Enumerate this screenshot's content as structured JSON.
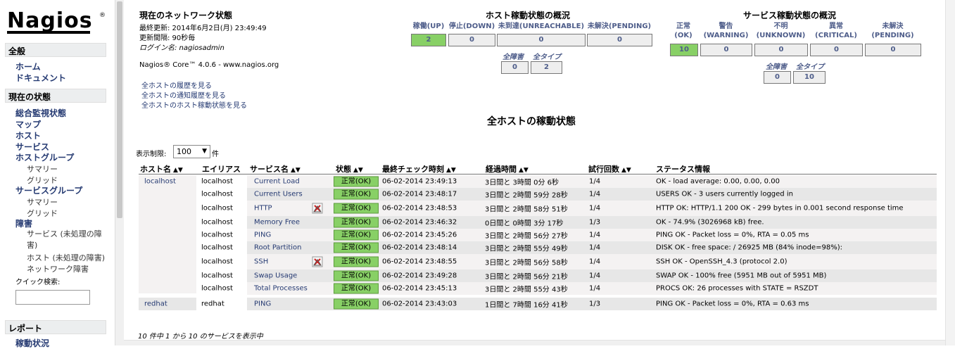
{
  "sidebar": {
    "logo": "Nagios",
    "sections": [
      {
        "title": "全般"
      },
      {
        "title": "現在の状態"
      },
      {
        "title": "レポート"
      }
    ],
    "general": [
      "ホーム",
      "ドキュメント"
    ],
    "current": [
      "総合監視状態",
      "マップ",
      "ホスト",
      "サービス",
      "ホストグループ"
    ],
    "hostgroup_sub": [
      "サマリー",
      "グリッド"
    ],
    "servicegroup": "サービスグループ",
    "servicegroup_sub": [
      "サマリー",
      "グリッド"
    ],
    "problems": "障害",
    "problems_sub": [
      "サービス (未処理の障害)",
      "ホスト (未処理の障害)",
      "ネットワーク障害"
    ],
    "quick_search_label": "クイック検索:",
    "reports_first": "稼動状況"
  },
  "info": {
    "title": "現在のネットワーク状態",
    "last_update": "最終更新: 2014年6月2日(月) 23:49:49",
    "interval": "更新間隔: 90秒毎",
    "login": "ログイン名: nagiosadmin",
    "core": "Nagios® Core™ 4.0.6 - www.nagios.org",
    "links": [
      "全ホストの履歴を見る",
      "全ホストの通知履歴を見る",
      "全ホストのホスト稼動状態を見る"
    ]
  },
  "host_summary": {
    "title": "ホスト稼動状態の概況",
    "headers": [
      "稼働(UP)",
      "停止(DOWN)",
      "未到達(UNREACHABLE)",
      "未解決(PENDING)"
    ],
    "values": [
      "2",
      "0",
      "0",
      "0"
    ],
    "sub_headers": [
      "全障害",
      "全タイプ"
    ],
    "sub_values": [
      "0",
      "2"
    ]
  },
  "service_summary": {
    "title": "サービス稼動状態の概況",
    "headers": [
      "正常\n(OK)",
      "警告\n(WARNING)",
      "不明\n(UNKNOWN)",
      "異常\n(CRITICAL)",
      "未解決\n(PENDING)"
    ],
    "values": [
      "10",
      "0",
      "0",
      "0",
      "0"
    ],
    "sub_headers": [
      "全障害",
      "全タイプ"
    ],
    "sub_values": [
      "0",
      "10"
    ]
  },
  "page_title": "全ホストの稼動状態",
  "limit": {
    "label": "表示制限:",
    "value": "100",
    "suffix": "件"
  },
  "columns": [
    "ホスト名",
    "エイリアス",
    "サービス名",
    "状態",
    "最終チェック時刻",
    "経過時間",
    "試行回数",
    "ステータス情報"
  ],
  "rows": [
    {
      "host": "localhost",
      "alias": "localhost",
      "service": "Current Load",
      "status": "正常(OK)",
      "last_check": "06-02-2014 23:49:13",
      "duration": "3日間と 3時間 0分 6秒",
      "attempt": "1/4",
      "info": "OK - load average: 0.00, 0.00, 0.00"
    },
    {
      "host": "",
      "alias": "localhost",
      "service": "Current Users",
      "status": "正常(OK)",
      "last_check": "06-02-2014 23:48:17",
      "duration": "3日間と 2時間 59分 28秒",
      "attempt": "1/4",
      "info": "USERS OK - 3 users currently logged in"
    },
    {
      "host": "",
      "alias": "localhost",
      "service": "HTTP",
      "status": "正常(OK)",
      "last_check": "06-02-2014 23:48:53",
      "duration": "3日間と 2時間 58分 51秒",
      "attempt": "1/4",
      "info": "HTTP OK: HTTP/1.1 200 OK - 299 bytes in 0.001 second response time"
    },
    {
      "host": "",
      "alias": "localhost",
      "service": "Memory Free",
      "status": "正常(OK)",
      "last_check": "06-02-2014 23:46:32",
      "duration": "0日間と 0時間 3分 17秒",
      "attempt": "1/3",
      "info": "OK - 74.9% (3026968 kB) free."
    },
    {
      "host": "",
      "alias": "localhost",
      "service": "PING",
      "status": "正常(OK)",
      "last_check": "06-02-2014 23:45:26",
      "duration": "3日間と 2時間 56分 27秒",
      "attempt": "1/4",
      "info": "PING OK - Packet loss = 0%, RTA = 0.05 ms"
    },
    {
      "host": "",
      "alias": "localhost",
      "service": "Root Partition",
      "status": "正常(OK)",
      "last_check": "06-02-2014 23:48:14",
      "duration": "3日間と 2時間 55分 49秒",
      "attempt": "1/4",
      "info": "DISK OK - free space: / 26925 MB (84% inode=98%):"
    },
    {
      "host": "",
      "alias": "localhost",
      "service": "SSH",
      "status": "正常(OK)",
      "last_check": "06-02-2014 23:48:55",
      "duration": "3日間と 2時間 56分 58秒",
      "attempt": "1/4",
      "info": "SSH OK - OpenSSH_4.3 (protocol 2.0)"
    },
    {
      "host": "",
      "alias": "localhost",
      "service": "Swap Usage",
      "status": "正常(OK)",
      "last_check": "06-02-2014 23:49:28",
      "duration": "3日間と 2時間 56分 21秒",
      "attempt": "1/4",
      "info": "SWAP OK - 100% free (5951 MB out of 5951 MB)"
    },
    {
      "host": "",
      "alias": "localhost",
      "service": "Total Processes",
      "status": "正常(OK)",
      "last_check": "06-02-2014 23:45:13",
      "duration": "3日間と 2時間 55分 43秒",
      "attempt": "1/4",
      "info": "PROCS OK: 26 processes with STATE = RSZDT"
    },
    {
      "host": "redhat",
      "alias": "redhat",
      "service": "PING",
      "status": "正常(OK)",
      "last_check": "06-02-2014 23:43:03",
      "duration": "1日間と 7時間 16分 41秒",
      "attempt": "1/3",
      "info": "PING OK - Packet loss = 0%, RTA = 0.63 ms"
    }
  ],
  "footer": "10 件中 1 から 10 のサービスを表示中",
  "colors": {
    "ok": "#88d066",
    "link": "#253a72",
    "row_odd": "#f4f2f2",
    "row_even": "#e7e7e7"
  }
}
